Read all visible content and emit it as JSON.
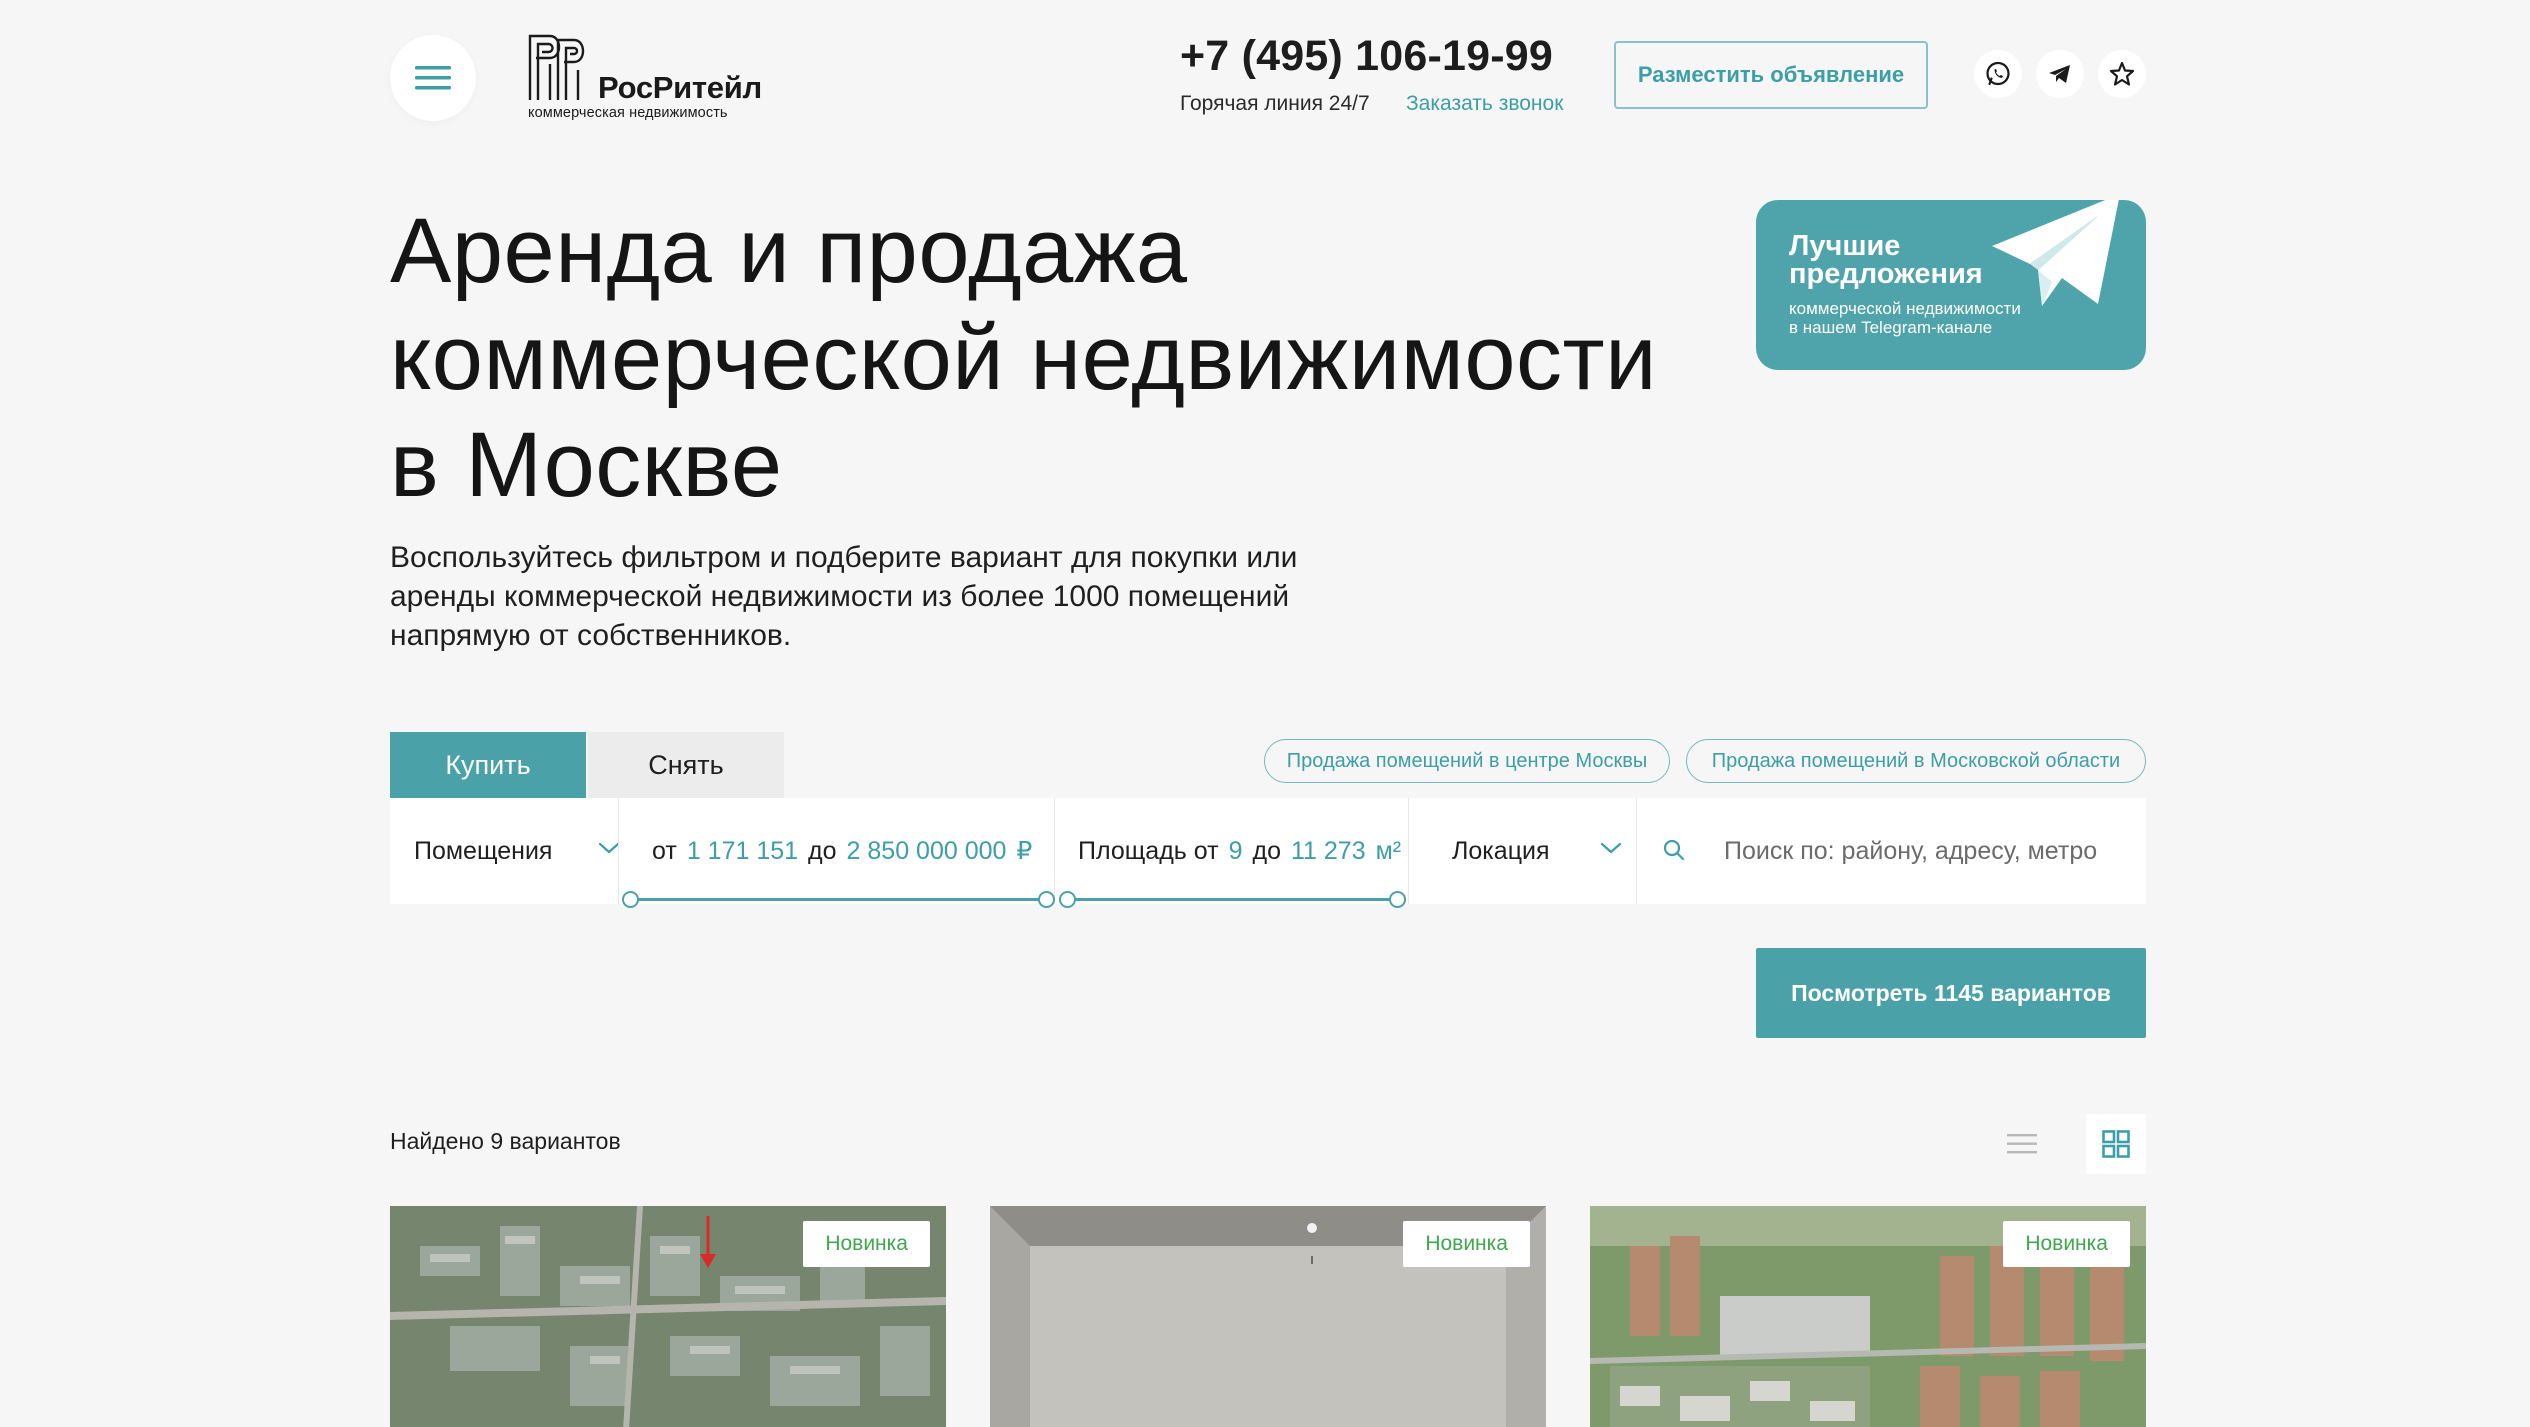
{
  "header": {
    "logo": {
      "title": "РосРитейл",
      "subtitle": "коммерческая недвижимость"
    },
    "phone": "+7 (495) 106-19-99",
    "hotline": "Горячая линия 24/7",
    "callback_link": "Заказать звонок",
    "post_ad_button": "Разместить объявление",
    "social_icons": [
      "whatsapp-icon",
      "telegram-icon",
      "star-icon"
    ]
  },
  "hero": {
    "title_line1": "Аренда и продажа",
    "title_line2": "коммерческой недвижимости",
    "title_line3": "в Москве",
    "description_line1": "Воспользуйтесь фильтром и подберите вариант для покупки или",
    "description_line2": "аренды коммерческой недвижимости из более 1000 помещений",
    "description_line3": "напрямую от собственников."
  },
  "telegram_banner": {
    "title_line1": "Лучшие",
    "title_line2": "предложения",
    "subtitle_line1": "коммерческой недвижимости",
    "subtitle_line2": "в нашем Telegram-канале"
  },
  "tabs": [
    {
      "label": "Купить",
      "active": true
    },
    {
      "label": "Снять",
      "active": false
    }
  ],
  "quick_links": [
    "Продажа помещений в центре Москвы",
    "Продажа помещений в Московской области"
  ],
  "filters": {
    "type": {
      "label": "Помещения"
    },
    "price": {
      "from_label": "от",
      "from_value": "1 171 151",
      "to_label": "до",
      "to_value": "2 850 000 000",
      "unit": "₽",
      "range_fraction": [
        0.0,
        1.0
      ]
    },
    "area": {
      "label": "Площадь от",
      "from_value": "9",
      "to_label": "до",
      "to_value": "11 273",
      "unit": "м²",
      "range_fraction": [
        0.0,
        1.0
      ]
    },
    "location": {
      "label": "Локация"
    },
    "search": {
      "placeholder": "Поиск по: району, адресу, метро"
    }
  },
  "view_button": "Посмотреть 1145 вариантов",
  "results": {
    "found_text": "Найдено 9 вариантов",
    "view_mode": "grid"
  },
  "cards": [
    {
      "badge": "Новинка"
    },
    {
      "badge": "Новинка"
    },
    {
      "badge": "Новинка"
    }
  ],
  "colors": {
    "accent": "#4aa2a8",
    "accent_text": "#3c9ea7",
    "badge_green": "#3fa84e",
    "background": "#f6f6f6"
  }
}
